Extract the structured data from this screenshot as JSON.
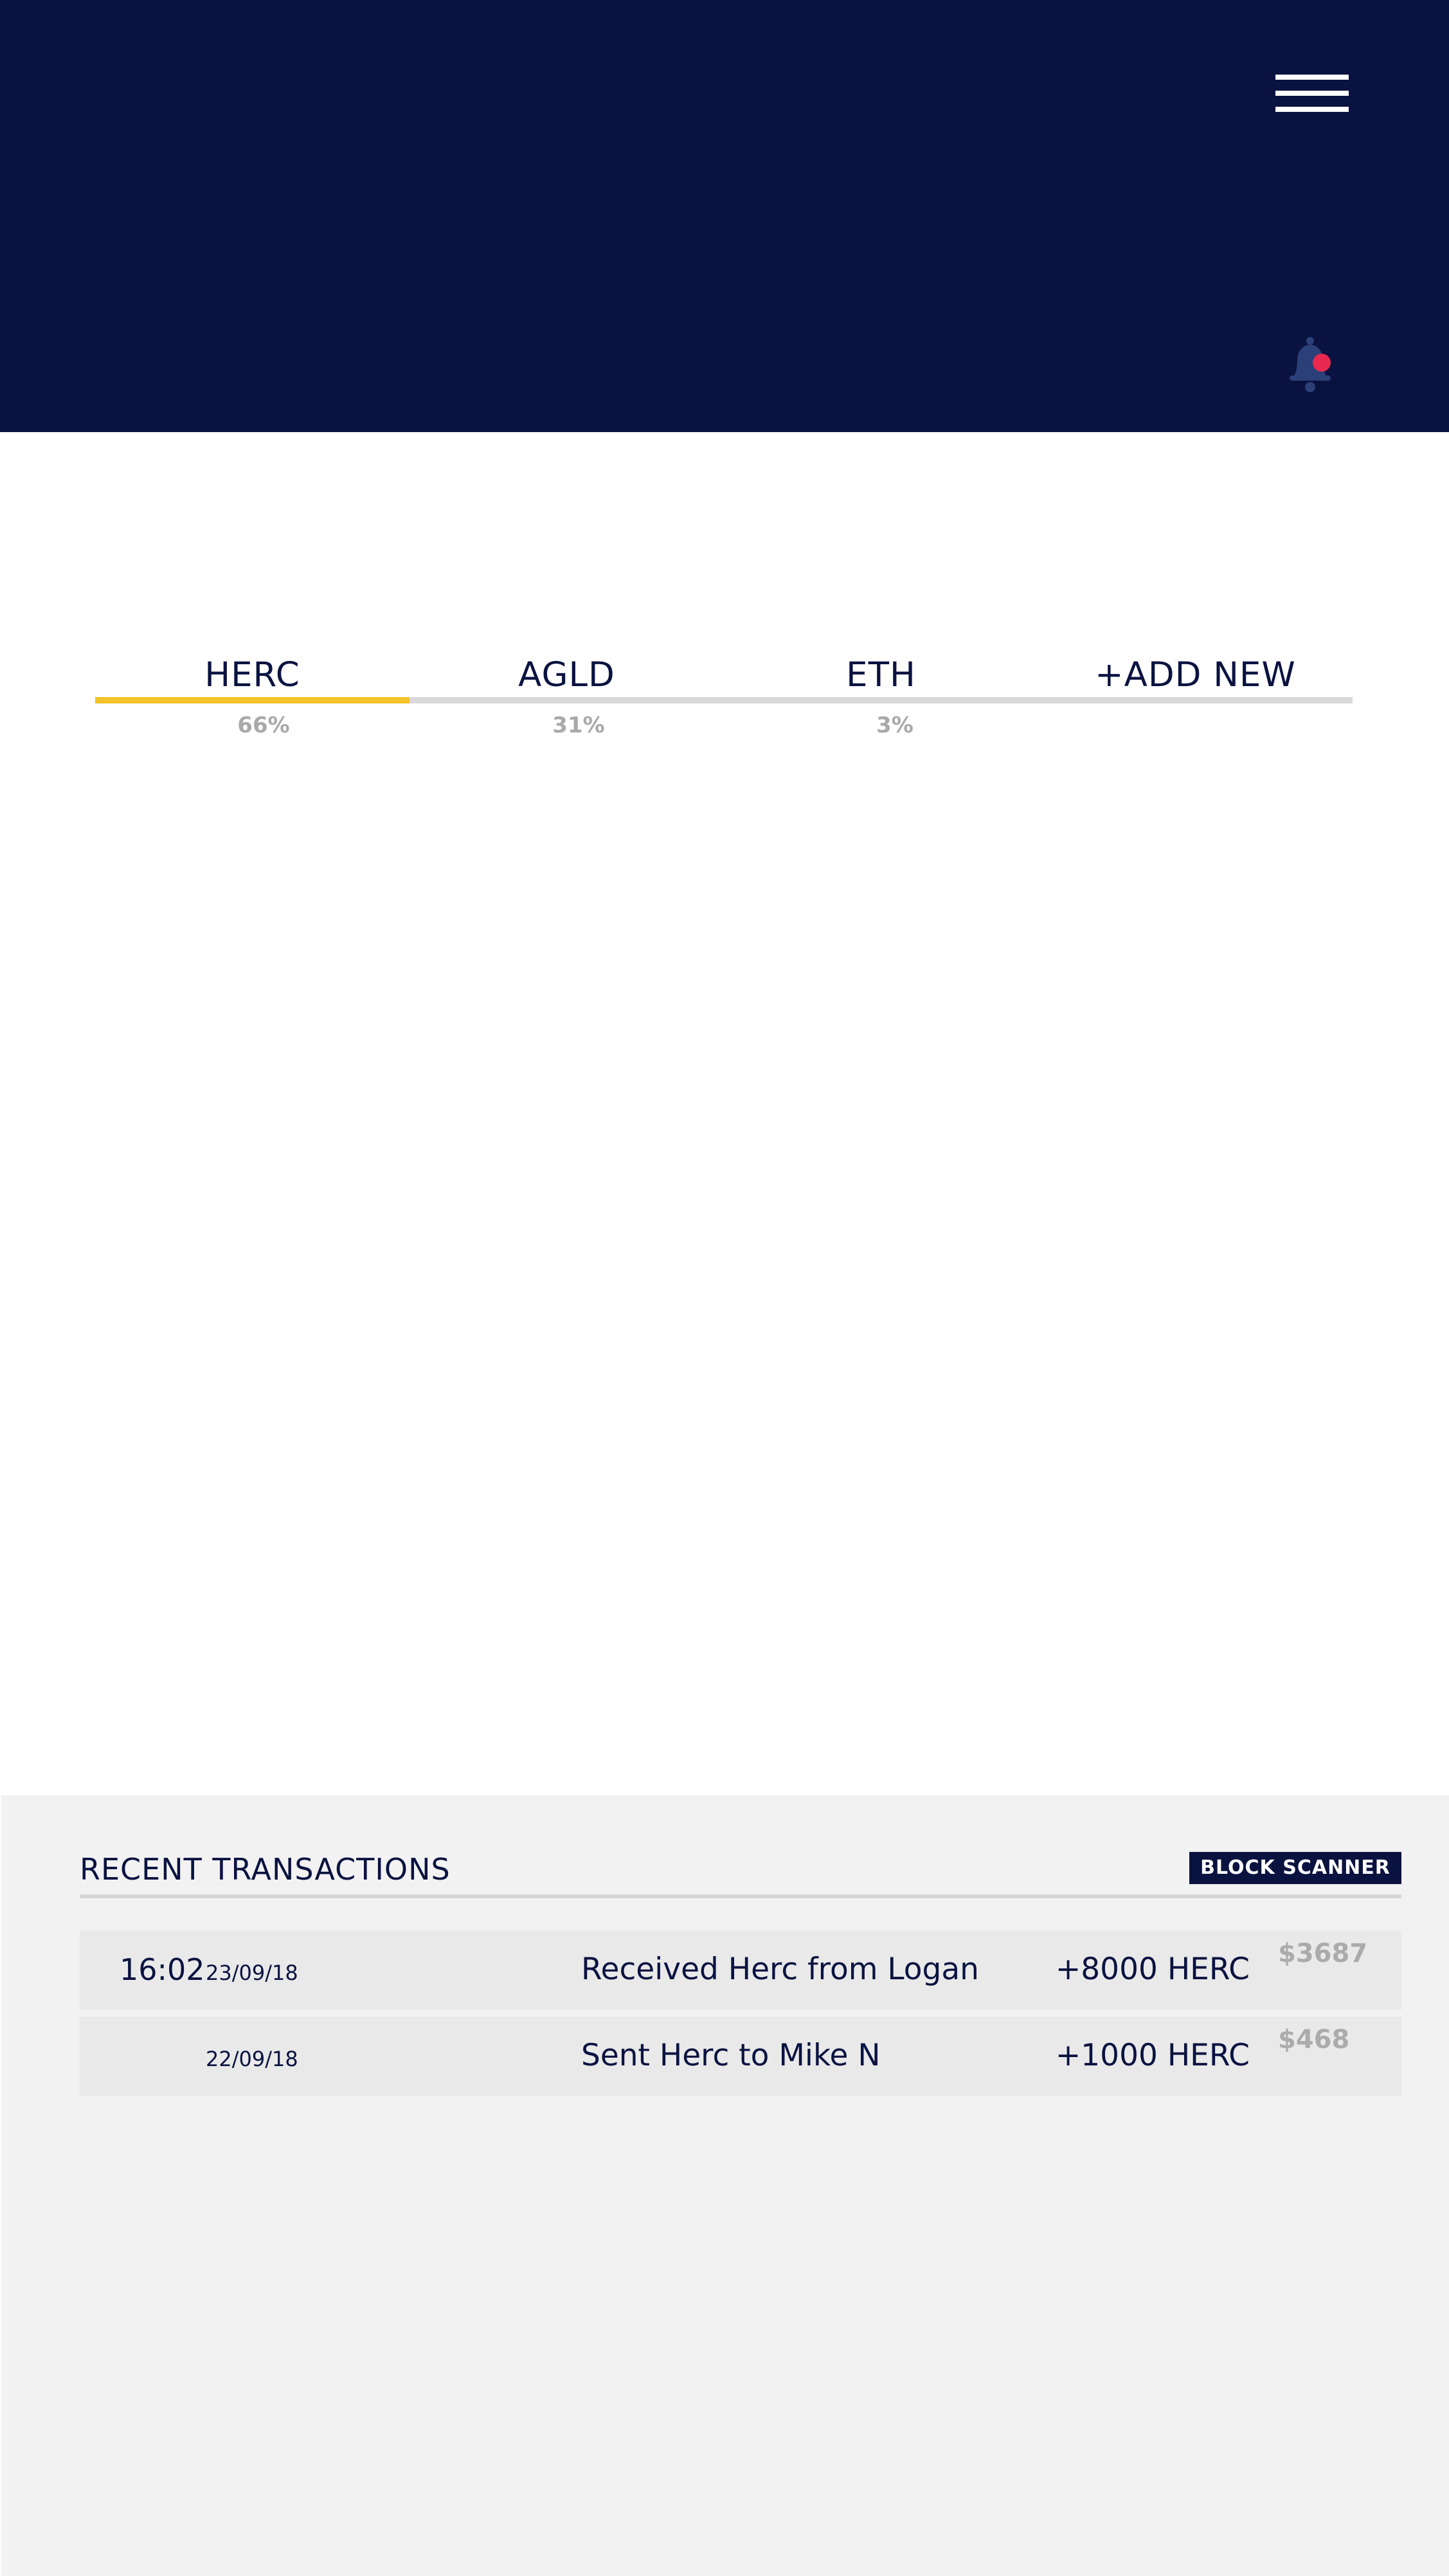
{
  "header": {
    "menu_icon": "hamburger-menu-icon",
    "notification_icon": "bell-icon",
    "notification_dot_color": "#e8294f",
    "background_color": "#0a1240"
  },
  "tabs": [
    {
      "label": "HERC",
      "percent": "66%",
      "selected": true
    },
    {
      "label": "AGLD",
      "percent": "31%",
      "selected": false
    },
    {
      "label": "ETH",
      "percent": "3%",
      "selected": false
    },
    {
      "label": "+ADD NEW",
      "percent": "",
      "selected": false
    }
  ],
  "accent_color": "#f2c32a",
  "transactions": {
    "title": "RECENT TRANSACTIONS",
    "block_scanner_label": "BLOCK SCANNER",
    "rows": [
      {
        "time": "16:02",
        "date": "23/09/18",
        "description": "Received Herc from Logan",
        "amount": "+8000 HERC",
        "usd": "$3687"
      },
      {
        "time": "",
        "date": "22/09/18",
        "description": "Sent Herc to Mike N",
        "amount": "+1000 HERC",
        "usd": "$468"
      }
    ]
  }
}
